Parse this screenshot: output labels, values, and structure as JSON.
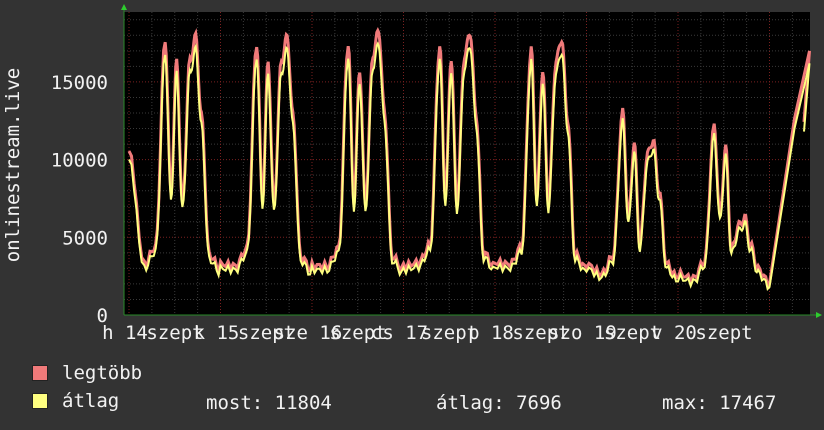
{
  "chart_data": {
    "type": "line",
    "ylabel": "onlinestream.live",
    "ylim": [
      0,
      19500
    ],
    "y_ticks": [
      0,
      5000,
      10000,
      15000
    ],
    "grid": true,
    "x_tick_labels": [
      "h 14",
      "szept",
      "k 15",
      "szept",
      "sze 16",
      "szept",
      "cs 17",
      "szept",
      "p 18",
      "szept",
      "szo 19",
      "szept",
      "v 20",
      "szept"
    ],
    "series": [
      {
        "name": "legtöbb",
        "color": "#f07a7a"
      },
      {
        "name": "átlag",
        "color": "#ffff80"
      }
    ],
    "days": [
      {
        "label": "h 14",
        "morning_peak": 17400,
        "noon_dip": 7400,
        "afternoon_peak": 16000,
        "evening_low": 6700,
        "night_peak": 17400,
        "night_min": 2700
      },
      {
        "label": "k 15",
        "morning_peak": 17200,
        "noon_dip": 7000,
        "afternoon_peak": 16000,
        "evening_low": 6600,
        "night_peak": 17400,
        "night_min": 2600
      },
      {
        "label": "sze 16",
        "morning_peak": 17200,
        "noon_dip": 6900,
        "afternoon_peak": 15500,
        "evening_low": 6700,
        "night_peak": 17800,
        "night_min": 2600
      },
      {
        "label": "cs 17",
        "morning_peak": 17000,
        "noon_dip": 7200,
        "afternoon_peak": 16300,
        "evening_low": 6700,
        "night_peak": 17700,
        "night_min": 2800
      },
      {
        "label": "p 18",
        "morning_peak": 16800,
        "noon_dip": 7000,
        "afternoon_peak": 15500,
        "evening_low": 6800,
        "night_peak": 17300,
        "night_min": 2700
      },
      {
        "label": "szo 19",
        "morning_peak": 12800,
        "noon_dip": 5800,
        "afternoon_peak": 10800,
        "evening_low": 4200,
        "night_peak": 10900,
        "night_min": 2100
      },
      {
        "label": "v 20",
        "morning_peak": 11900,
        "noon_dip": 6000,
        "afternoon_peak": 10500,
        "evening_low": 3900,
        "night_peak": 6000,
        "night_min": 1800
      }
    ],
    "end_value": 11804
  },
  "legend": {
    "max_label": "legtöbb",
    "avg_label": "átlag",
    "max_color": "#f07a7a",
    "avg_color": "#ffff80"
  },
  "stats": {
    "now": "most: 11804",
    "avg": "átlag: 7696",
    "max": "max: 17467"
  }
}
